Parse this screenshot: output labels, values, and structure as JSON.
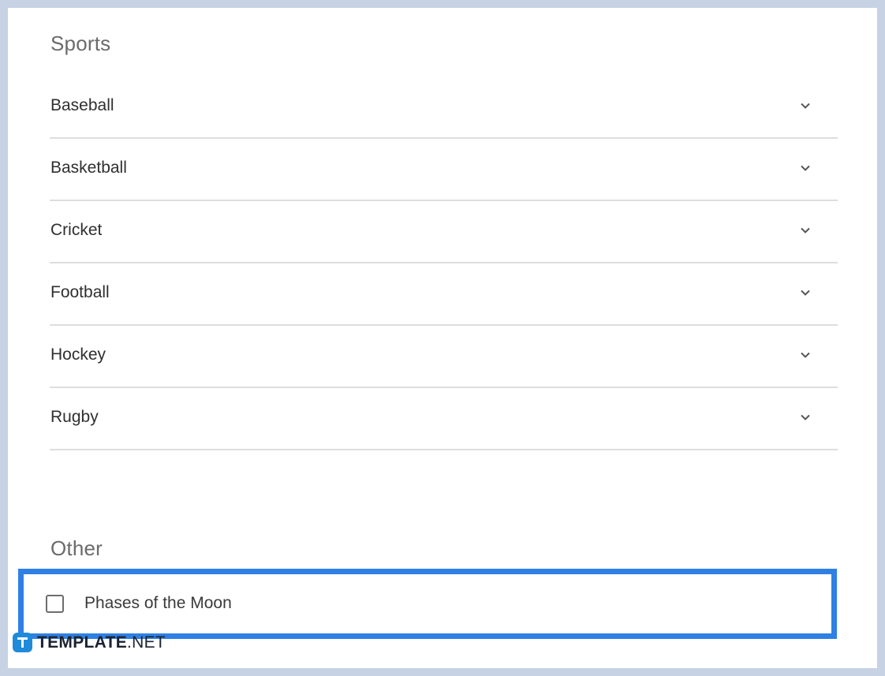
{
  "sections": {
    "sports": {
      "title": "Sports",
      "items": [
        {
          "label": "Baseball",
          "icon": "chevron-down-icon"
        },
        {
          "label": "Basketball",
          "icon": "chevron-down-icon"
        },
        {
          "label": "Cricket",
          "icon": "chevron-down-icon"
        },
        {
          "label": "Football",
          "icon": "chevron-down-icon"
        },
        {
          "label": "Hockey",
          "icon": "chevron-down-icon"
        },
        {
          "label": "Rugby",
          "icon": "chevron-down-icon"
        }
      ]
    },
    "other": {
      "title": "Other",
      "checkbox": {
        "label": "Phases of the Moon",
        "checked": false
      }
    }
  },
  "highlight": {
    "color": "#2f80e4"
  },
  "watermark": {
    "brand": "TEMPLATE",
    "suffix": ".NET",
    "badge_color": "#1f8ad9"
  },
  "colors": {
    "background": "#c7d2e4",
    "panel": "#ffffff",
    "divider": "#dedede"
  }
}
